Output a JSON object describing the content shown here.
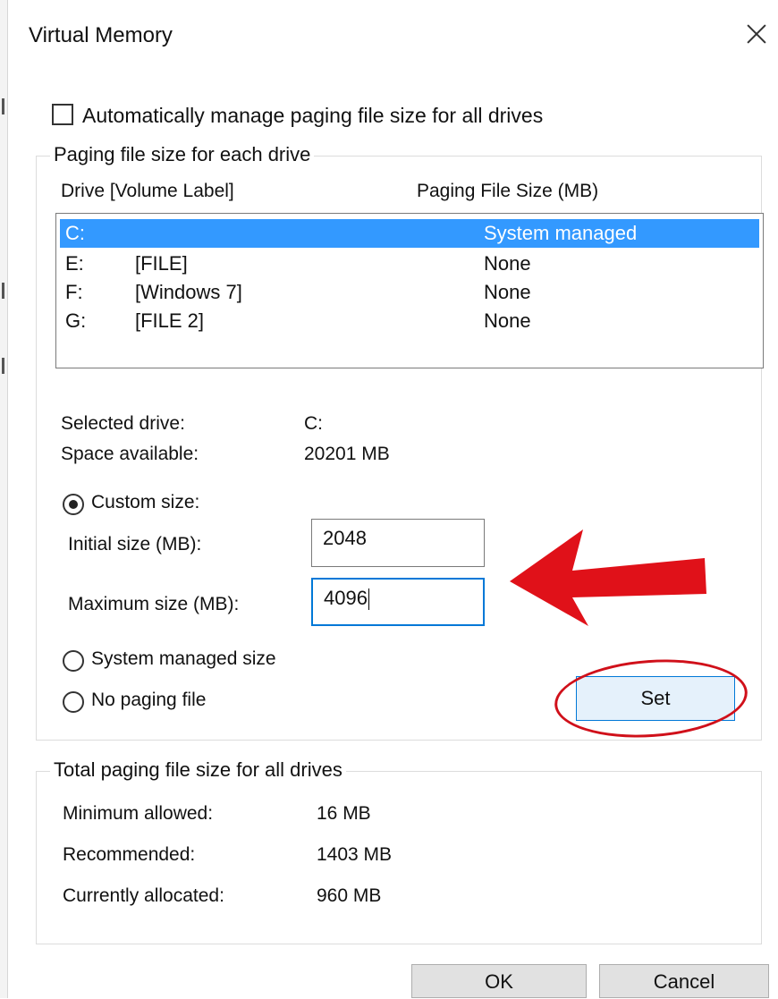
{
  "window": {
    "title": "Virtual Memory",
    "close_icon": "close-icon"
  },
  "auto_manage": {
    "label": "Automatically manage paging file size for all drives",
    "checked": false
  },
  "paging_group": {
    "legend": "Paging file size for each drive",
    "headers": {
      "drive": "Drive  [Volume Label]",
      "size": "Paging File Size (MB)"
    },
    "drives": [
      {
        "drive": "C:",
        "label": "",
        "size": "System managed",
        "selected": true
      },
      {
        "drive": "E:",
        "label": "[FILE]",
        "size": "None",
        "selected": false
      },
      {
        "drive": "F:",
        "label": "[Windows 7]",
        "size": "None",
        "selected": false
      },
      {
        "drive": "G:",
        "label": "[FILE 2]",
        "size": "None",
        "selected": false
      }
    ],
    "selected_drive_label": "Selected drive:",
    "selected_drive_value": "C:",
    "space_available_label": "Space available:",
    "space_available_value": "20201 MB",
    "custom_size": {
      "label": "Custom size:",
      "selected": true
    },
    "initial_size": {
      "label": "Initial size (MB):",
      "value": "2048"
    },
    "maximum_size": {
      "label": "Maximum size (MB):",
      "value": "4096"
    },
    "system_managed": {
      "label": "System managed size",
      "selected": false
    },
    "no_paging": {
      "label": "No paging file",
      "selected": false
    },
    "set_button": "Set"
  },
  "totals_group": {
    "legend": "Total paging file size for all drives",
    "minimum_label": "Minimum allowed:",
    "minimum_value": "16 MB",
    "recommended_label": "Recommended:",
    "recommended_value": "1403 MB",
    "allocated_label": "Currently allocated:",
    "allocated_value": "960 MB"
  },
  "buttons": {
    "ok": "OK",
    "cancel": "Cancel"
  },
  "annotation_color": "#d0101a",
  "selection_color": "#3399ff"
}
